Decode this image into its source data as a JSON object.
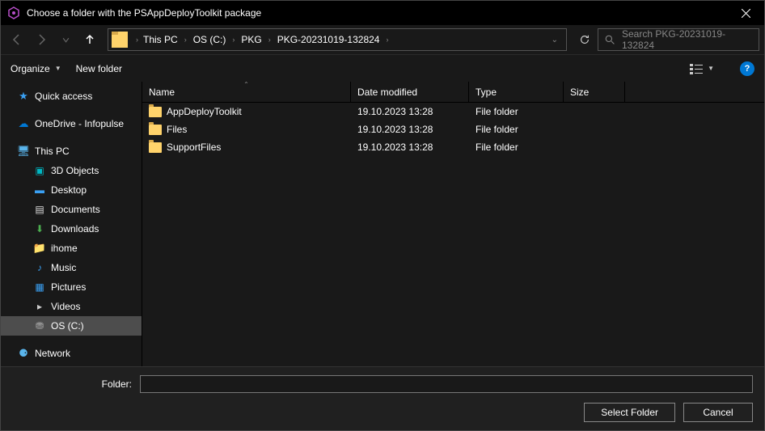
{
  "titlebar": {
    "title": "Choose a folder with the PSAppDeployToolkit package"
  },
  "breadcrumb": {
    "items": [
      "This PC",
      "OS (C:)",
      "PKG",
      "PKG-20231019-132824"
    ]
  },
  "search": {
    "placeholder": "Search PKG-20231019-132824"
  },
  "toolbar": {
    "organize": "Organize",
    "newfolder": "New folder"
  },
  "sidebar": {
    "quick_access": "Quick access",
    "onedrive": "OneDrive - Infopulse",
    "this_pc": "This PC",
    "pc_items": [
      "3D Objects",
      "Desktop",
      "Documents",
      "Downloads",
      "ihome",
      "Music",
      "Pictures",
      "Videos",
      "OS (C:)"
    ],
    "network": "Network"
  },
  "columns": {
    "name": "Name",
    "date": "Date modified",
    "type": "Type",
    "size": "Size"
  },
  "rows": [
    {
      "name": "AppDeployToolkit",
      "date": "19.10.2023 13:28",
      "type": "File folder",
      "size": ""
    },
    {
      "name": "Files",
      "date": "19.10.2023 13:28",
      "type": "File folder",
      "size": ""
    },
    {
      "name": "SupportFiles",
      "date": "19.10.2023 13:28",
      "type": "File folder",
      "size": ""
    }
  ],
  "bottom": {
    "folder_label": "Folder:",
    "folder_value": "",
    "select": "Select Folder",
    "cancel": "Cancel"
  }
}
